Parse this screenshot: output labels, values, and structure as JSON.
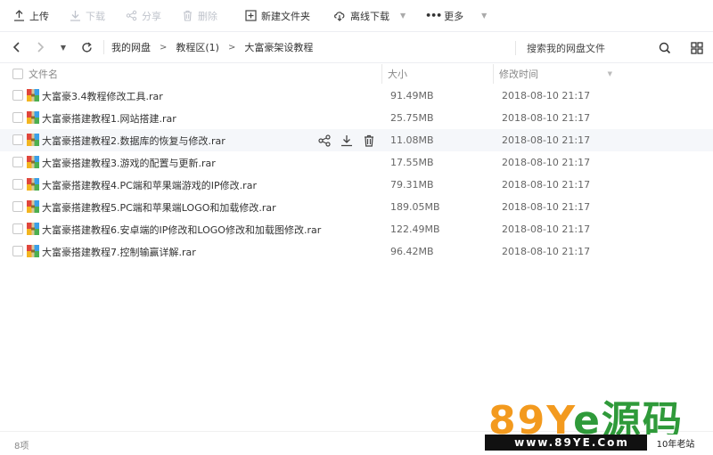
{
  "toolbar": {
    "upload": "上传",
    "download": "下载",
    "share": "分享",
    "delete": "删除",
    "new_folder": "新建文件夹",
    "offline_download": "离线下载",
    "more": "更多"
  },
  "nav": {
    "crumbs": [
      "我的网盘",
      "教程区(1)",
      "大富豪架设教程"
    ],
    "search_placeholder": "搜索我的网盘文件"
  },
  "table": {
    "headers": {
      "name": "文件名",
      "size": "大小",
      "time": "修改时间"
    },
    "rows": [
      {
        "name": "大富豪3.4教程修改工具.rar",
        "size": "91.49MB",
        "time": "2018-08-10 21:17"
      },
      {
        "name": "大富豪搭建教程1.网站搭建.rar",
        "size": "25.75MB",
        "time": "2018-08-10 21:17"
      },
      {
        "name": "大富豪搭建教程2.数据库的恢复与修改.rar",
        "size": "11.08MB",
        "time": "2018-08-10 21:17"
      },
      {
        "name": "大富豪搭建教程3.游戏的配置与更新.rar",
        "size": "17.55MB",
        "time": "2018-08-10 21:17"
      },
      {
        "name": "大富豪搭建教程4.PC端和苹果端游戏的IP修改.rar",
        "size": "79.31MB",
        "time": "2018-08-10 21:17"
      },
      {
        "name": "大富豪搭建教程5.PC端和苹果端LOGO和加载修改.rar",
        "size": "189.05MB",
        "time": "2018-08-10 21:17"
      },
      {
        "name": "大富豪搭建教程6.安卓端的IP修改和LOGO修改和加载图修改.rar",
        "size": "122.49MB",
        "time": "2018-08-10 21:17"
      },
      {
        "name": "大富豪搭建教程7.控制输赢详解.rar",
        "size": "96.42MB",
        "time": "2018-08-10 21:17"
      }
    ]
  },
  "footer": {
    "count": "8项"
  },
  "watermark": {
    "big_orange": "89Y",
    "big_green": "e源码",
    "url": "www.89YE.Com",
    "tag": "10年老站"
  },
  "colors": {
    "accent": "#06a7ff",
    "watermark_orange": "#f39a1e",
    "watermark_green": "#2f9a3a"
  }
}
